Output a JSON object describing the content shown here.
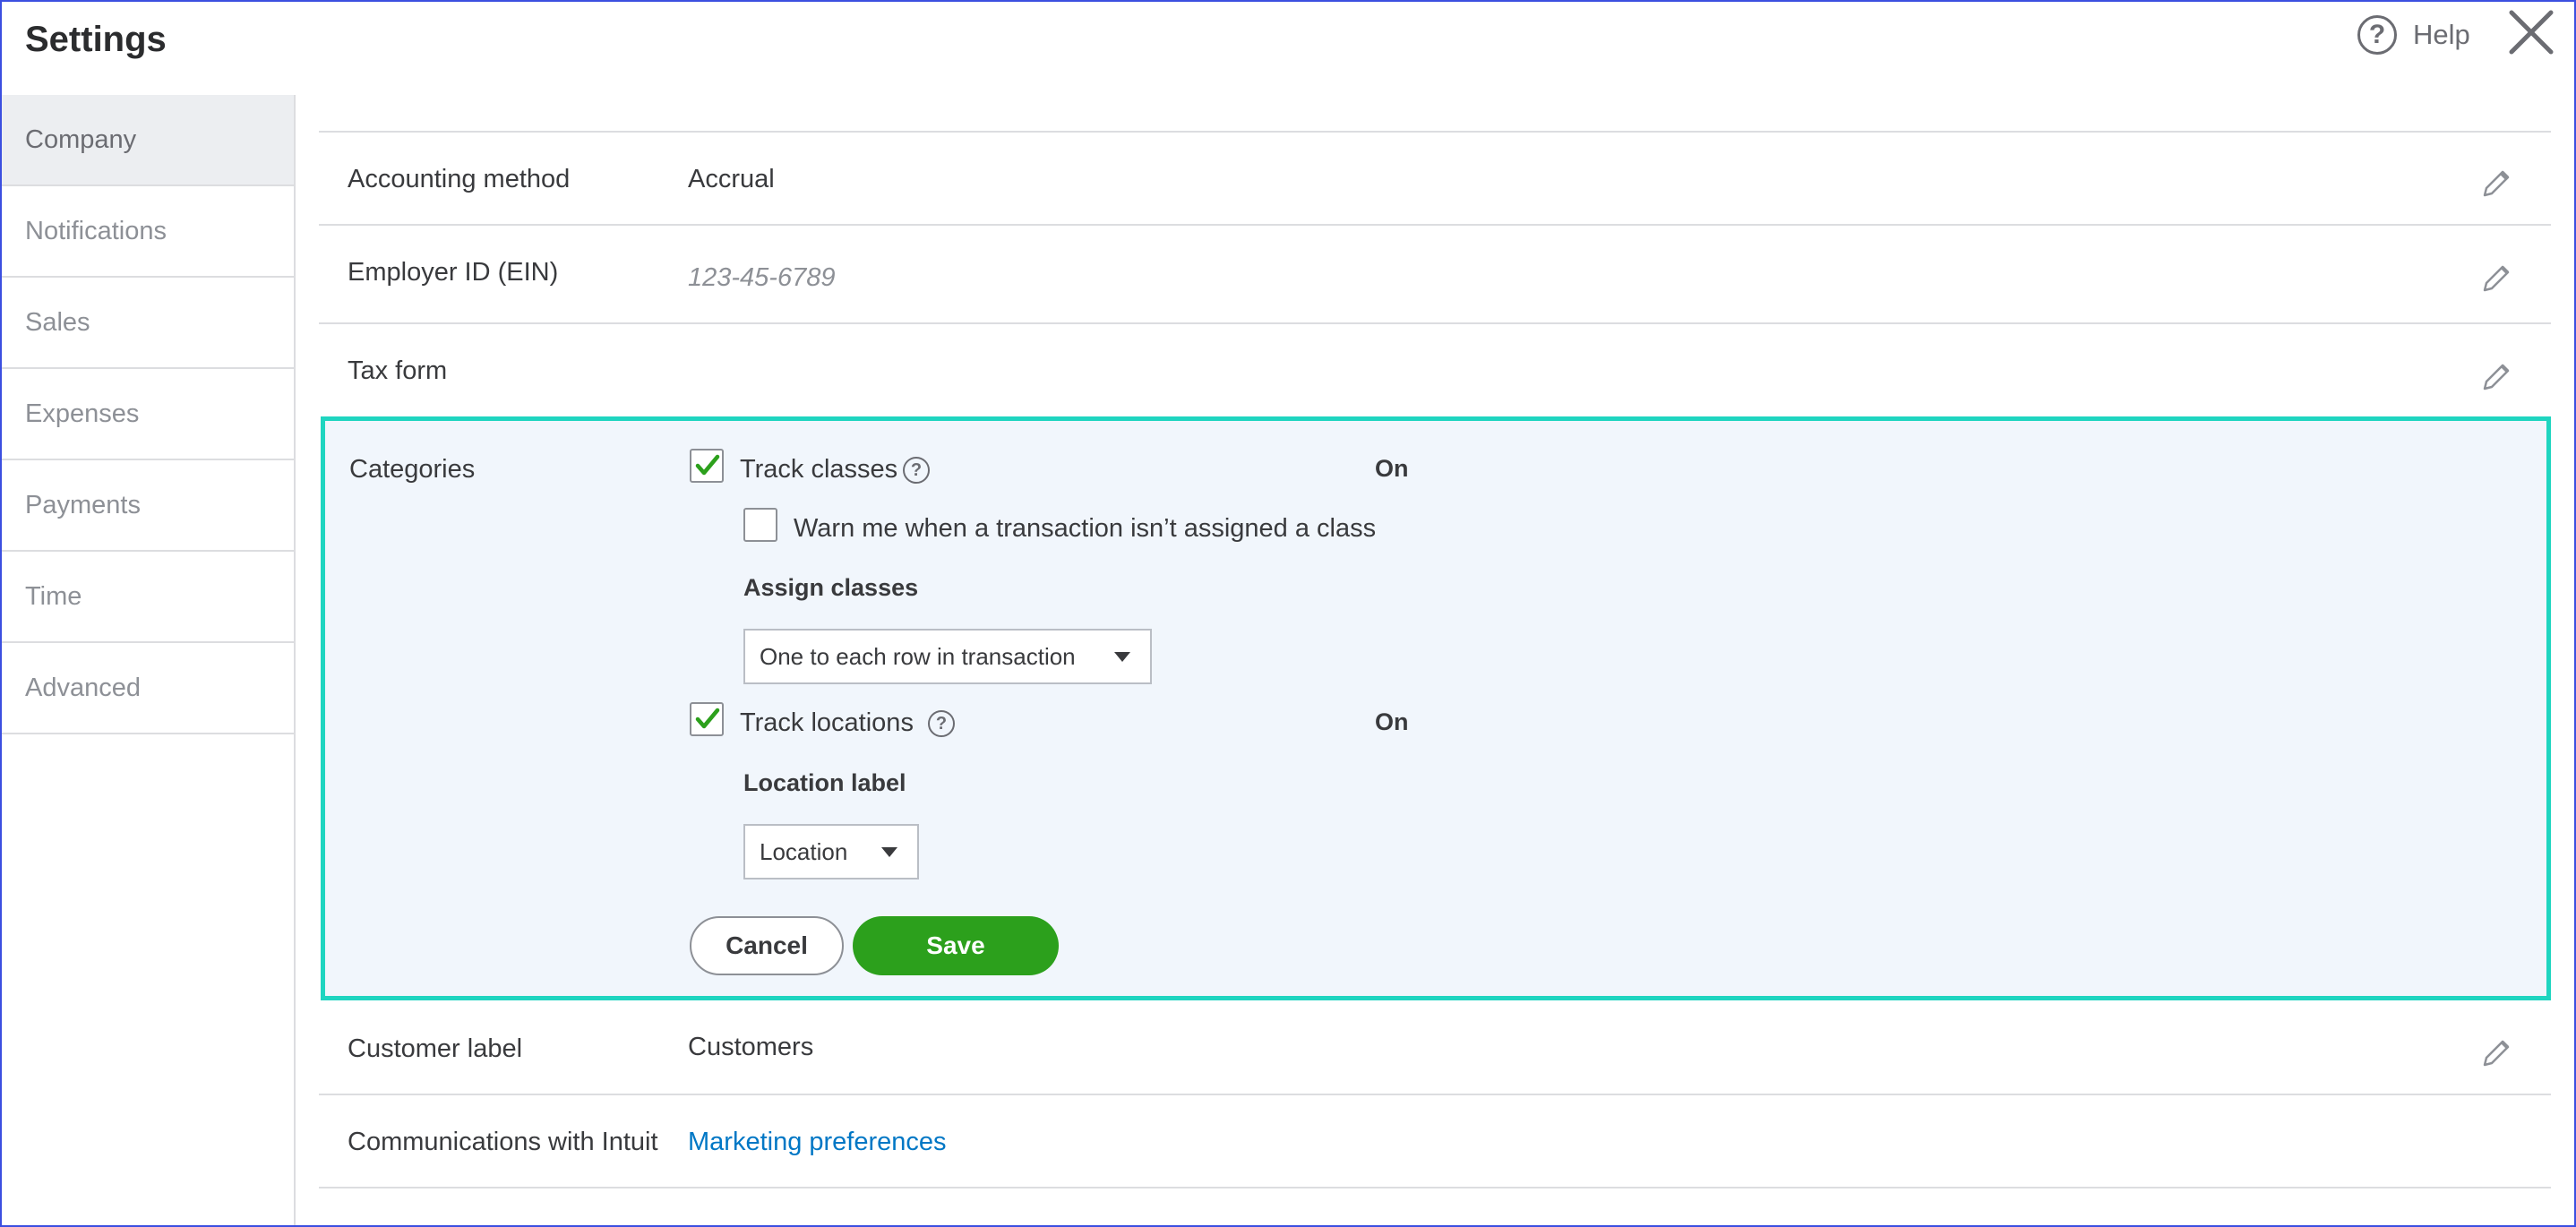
{
  "header": {
    "title": "Settings",
    "help_label": "Help",
    "help_icon": "question-circle-icon",
    "close_icon": "close-icon"
  },
  "sidebar": {
    "items": [
      {
        "label": "Company",
        "active": true
      },
      {
        "label": "Notifications"
      },
      {
        "label": "Sales"
      },
      {
        "label": "Expenses"
      },
      {
        "label": "Payments"
      },
      {
        "label": "Time"
      },
      {
        "label": "Advanced"
      }
    ]
  },
  "rows": {
    "accounting_method": {
      "label": "Accounting method",
      "value": "Accrual"
    },
    "employer_id": {
      "label": "Employer ID (EIN)",
      "placeholder": "123-45-6789"
    },
    "tax_form": {
      "label": "Tax form"
    },
    "customer_label": {
      "label": "Customer label",
      "value": "Customers"
    },
    "communications": {
      "label": "Communications with Intuit",
      "link": "Marketing preferences"
    }
  },
  "categories": {
    "label": "Categories",
    "track_classes": {
      "label": "Track classes",
      "checked": true,
      "status": "On"
    },
    "warn_unassigned": {
      "label": "Warn me when a transaction isn’t assigned a class",
      "checked": false
    },
    "assign_classes": {
      "label": "Assign classes",
      "selected": "One to each row in transaction"
    },
    "track_locations": {
      "label": "Track locations",
      "checked": true,
      "status": "On"
    },
    "location_label": {
      "label": "Location label",
      "selected": "Location"
    },
    "cancel_label": "Cancel",
    "save_label": "Save",
    "colors": {
      "accent_green": "#2ca01c",
      "highlight_border": "#1fd5c0",
      "link_blue": "#0077c5"
    }
  }
}
